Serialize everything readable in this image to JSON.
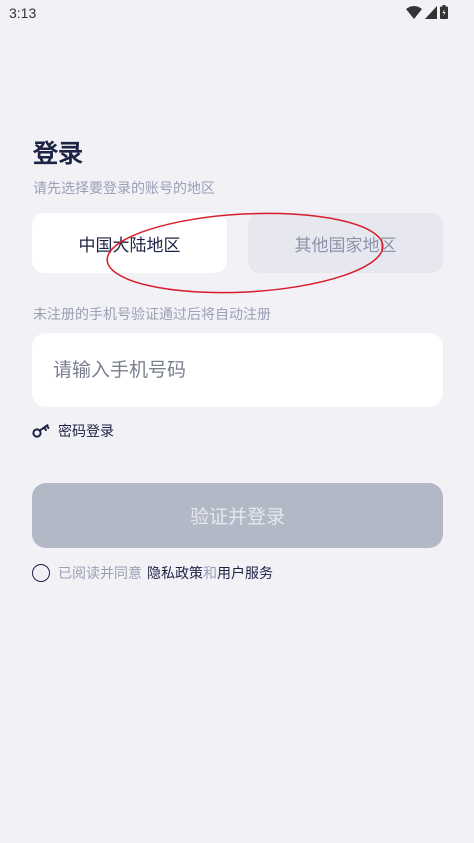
{
  "status_bar": {
    "time": "3:13",
    "icons": [
      "wifi-icon",
      "signal-icon",
      "battery-icon"
    ]
  },
  "login": {
    "title": "登录",
    "subtitle": "请先选择要登录的账号的地区",
    "regions": [
      {
        "label": "中国大陆地区",
        "selected": true
      },
      {
        "label": "其他国家地区",
        "selected": false
      }
    ],
    "hint": "未注册的手机号验证通过后将自动注册",
    "phone_placeholder": "请输入手机号码",
    "password_login_label": "密码登录",
    "submit_label": "验证并登录",
    "agreement": {
      "prefix": "已阅读并同意",
      "privacy_link": "隐私政策",
      "conjunction": "和",
      "terms_link": "用户服务"
    }
  },
  "colors": {
    "background": "#f2f1f6",
    "primary_text": "#1d2345",
    "muted_text": "#9aa0b5",
    "disabled_button": "#b3b8c6",
    "annotation": "#d81e2a"
  }
}
